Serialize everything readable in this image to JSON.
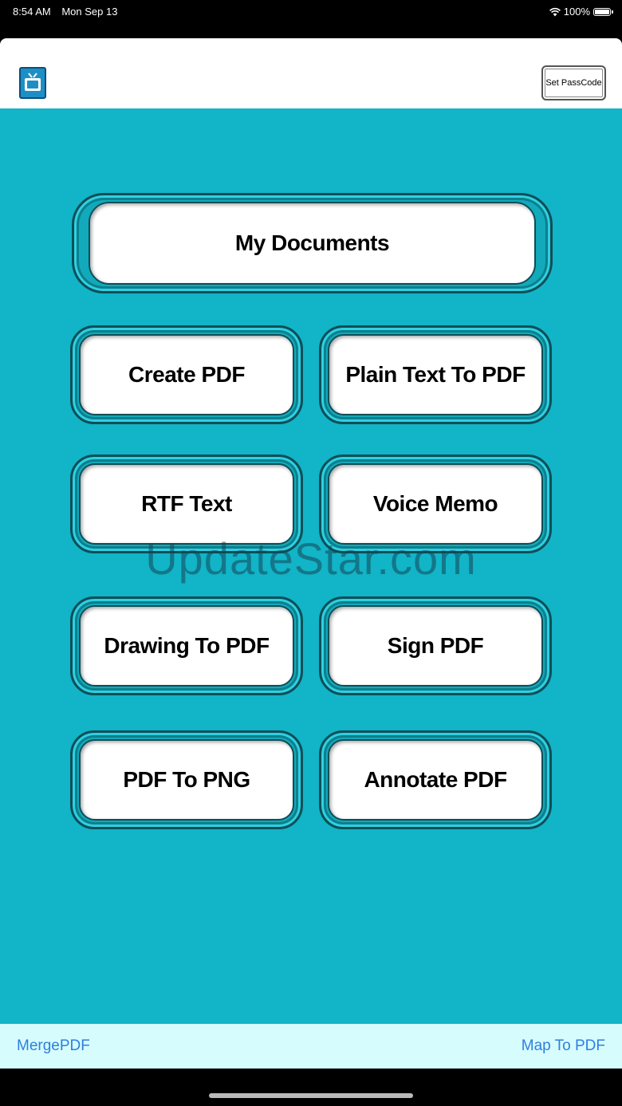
{
  "status_bar": {
    "time": "8:54 AM",
    "date": "Mon Sep 13",
    "battery_percent": "100%",
    "wifi_icon": "wifi-icon",
    "battery_icon": "battery-icon"
  },
  "header": {
    "app_icon": "tv-icon",
    "passcode_label": "Set PassCode"
  },
  "menu": {
    "my_documents": "My Documents",
    "create_pdf": "Create PDF",
    "plain_text_to_pdf": "Plain Text To PDF",
    "rtf_text": "RTF Text",
    "voice_memo": "Voice Memo",
    "drawing_to_pdf": "Drawing To PDF",
    "sign_pdf": "Sign PDF",
    "pdf_to_png": "PDF To PNG",
    "annotate_pdf": "Annotate PDF"
  },
  "watermark": "UpdateStar.com",
  "footer": {
    "merge_pdf": "MergePDF",
    "map_to_pdf": "Map To PDF"
  },
  "colors": {
    "main_background": "#12b4c7",
    "footer_background": "#d6fcfd",
    "link_color": "#2f7fdf"
  }
}
